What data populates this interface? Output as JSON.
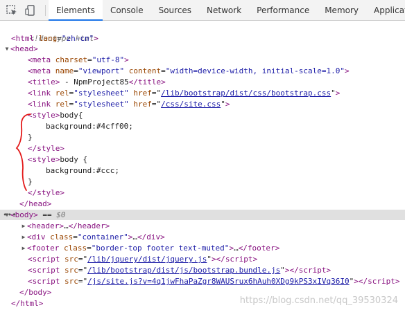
{
  "tabs": [
    "Elements",
    "Console",
    "Sources",
    "Network",
    "Performance",
    "Memory",
    "Application"
  ],
  "active_tab": "Elements",
  "dom": {
    "doctype": "<!doctype html>",
    "html_tag": "html",
    "html_attr_name": "lang",
    "html_attr_value": "\"zh-cn\"",
    "head_tag": "head",
    "meta1_tag": "meta",
    "meta1_attr": "charset",
    "meta1_val": "\"utf-8\"",
    "meta2_tag": "meta",
    "meta2_attr1": "name",
    "meta2_val1": "\"viewport\"",
    "meta2_attr2": "content",
    "meta2_val2": "\"width=device-width, initial-scale=1.0\"",
    "title_tag": "title",
    "title_text": " - NpmProject85",
    "link1_tag": "link",
    "link1_attr1": "rel",
    "link1_val1": "\"stylesheet\"",
    "link1_attr2": "href",
    "link1_href": "/lib/bootstrap/dist/css/bootstrap.css",
    "link2_href": "/css/site.css",
    "style_tag": "style",
    "style1_sel": "body{",
    "style1_prop": "background:#4cff00;",
    "close_brace": "}",
    "style2_sel": "body {",
    "style2_prop": "background:#ccc;",
    "body_tag": "body",
    "body_eq": " == ",
    "body_var": "$0",
    "header_tag": "header",
    "ellipsis": "…",
    "div_tag": "div",
    "div_attr": "class",
    "div_val": "\"container\"",
    "footer_tag": "footer",
    "footer_attr": "class",
    "footer_val": "\"border-top footer text-muted\"",
    "script_tag": "script",
    "script_attr": "src",
    "script1_src": "/lib/jquery/dist/jquery.js",
    "script2_src": "/lib/bootstrap/dist/js/bootstrap.bundle.js",
    "script3_src": "/js/site.js?v=4q1jwFhaPaZgr8WAUSrux6hAuh0XDg9kPS3xIVq36I0"
  },
  "watermark": "https://blog.csdn.net/qq_39530324",
  "colors": {
    "tag": "#881280",
    "attr": "#994500",
    "value": "#1a1aa6",
    "annotation": "#e31a1a",
    "active_tab_underline": "#1a73e8"
  },
  "icons": [
    "inspect-element-icon",
    "device-toolbar-icon"
  ]
}
